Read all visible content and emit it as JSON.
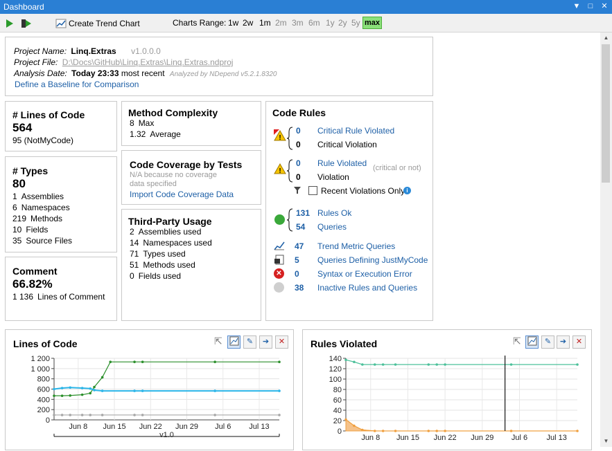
{
  "window": {
    "title": "Dashboard"
  },
  "toolbar": {
    "create_trend_chart": "Create Trend Chart",
    "charts_range_label": "Charts Range:",
    "ranges": [
      "1w",
      "2w",
      "1m",
      "2m",
      "3m",
      "6m",
      "1y",
      "2y",
      "5y"
    ],
    "max": "max"
  },
  "project": {
    "name_label": "Project Name:",
    "name": "Linq.Extras",
    "version": "v1.0.0.0",
    "file_label": "Project File:",
    "file": "D:\\Docs\\GitHub\\Linq.Extras\\Linq.Extras.ndproj",
    "date_label": "Analysis Date:",
    "date": "Today 23:33",
    "most_recent": "most recent",
    "analyzed_by": "Analyzed by NDepend v5.2.1.8320",
    "baseline_link": "Define a Baseline for Comparison"
  },
  "loc": {
    "title": "# Lines of Code",
    "value": "564",
    "not_my_code": "95  (NotMyCode)"
  },
  "types": {
    "title": "# Types",
    "value": "80",
    "rows": [
      {
        "n": "1",
        "label": "Assemblies"
      },
      {
        "n": "6",
        "label": "Namespaces"
      },
      {
        "n": "219",
        "label": "Methods"
      },
      {
        "n": "10",
        "label": "Fields"
      },
      {
        "n": "35",
        "label": "Source Files"
      }
    ]
  },
  "comment": {
    "title": "Comment",
    "value": "66.82%",
    "n": "1 136",
    "label": "Lines of Comment"
  },
  "complexity": {
    "title": "Method Complexity",
    "max_n": "8",
    "max_label": "Max",
    "avg_n": "1.32",
    "avg_label": "Average"
  },
  "coverage": {
    "title": "Code Coverage by Tests",
    "na": "N/A because no coverage",
    "na2": "data specified",
    "import_link": "Import Code Coverage Data"
  },
  "third_party": {
    "title": "Third-Party Usage",
    "rows": [
      {
        "n": "2",
        "label": "Assemblies used"
      },
      {
        "n": "14",
        "label": "Namespaces used"
      },
      {
        "n": "71",
        "label": "Types used"
      },
      {
        "n": "51",
        "label": "Methods used"
      },
      {
        "n": "0",
        "label": "Fields used"
      }
    ]
  },
  "code_rules": {
    "title": "Code Rules",
    "critical_n": "0",
    "critical_label": "Critical Rule Violated",
    "critical_viol_n": "0",
    "critical_viol_label": "Critical Violation",
    "violated_n": "0",
    "violated_label": "Rule Violated",
    "critical_or_not": "(critical or not)",
    "violation_n": "0",
    "violation_label": "Violation",
    "recent_only": "Recent Violations Only",
    "ok_n": "131",
    "ok_label": "Rules Ok",
    "queries_n": "54",
    "queries_label": "Queries",
    "trend_n": "47",
    "trend_label": "Trend Metric Queries",
    "jmc_n": "5",
    "jmc_label": "Queries Defining JustMyCode",
    "err_n": "0",
    "err_label": "Syntax or Execution Error",
    "inactive_n": "38",
    "inactive_label": "Inactive Rules and Queries"
  },
  "chart_data": [
    {
      "type": "line",
      "title": "Lines of Code",
      "ylim": [
        0,
        1200
      ],
      "y_ticks": [
        "1 200",
        "1 000",
        "800",
        "600",
        "400",
        "200",
        "0"
      ],
      "x_ticks": [
        "Jun 8",
        "Jun 15",
        "Jun 22",
        "Jun 29",
        "Jul 6",
        "Jul 13"
      ],
      "annotation": "v1.0",
      "series": [
        {
          "color": "#2a8f2a",
          "x": [
            0,
            2,
            4,
            7,
            9,
            10,
            12,
            14,
            20,
            22,
            40,
            56
          ],
          "values": [
            470,
            470,
            475,
            490,
            520,
            640,
            830,
            1130,
            1130,
            1130,
            1130,
            1130
          ]
        },
        {
          "color": "#2bb5e8",
          "x": [
            0,
            2,
            4,
            7,
            9,
            10,
            12,
            20,
            22,
            40,
            56
          ],
          "values": [
            600,
            620,
            630,
            620,
            610,
            580,
            565,
            565,
            565,
            565,
            565
          ]
        },
        {
          "color": "#a8a8a8",
          "x": [
            0,
            2,
            4,
            7,
            9,
            12,
            20,
            22,
            40,
            56
          ],
          "values": [
            95,
            95,
            95,
            95,
            95,
            95,
            95,
            95,
            95,
            95
          ]
        }
      ]
    },
    {
      "type": "line",
      "title": "Rules Violated",
      "ylim": [
        0,
        140
      ],
      "y_ticks": [
        "140",
        "120",
        "100",
        "80",
        "60",
        "40",
        "20",
        "0"
      ],
      "x_ticks": [
        "Jun 8",
        "Jun 15",
        "Jun 22",
        "Jun 29",
        "Jul 6",
        "Jul 13"
      ],
      "series": [
        {
          "color": "#4cc09a",
          "x": [
            0,
            2,
            4,
            7,
            9,
            12,
            20,
            22,
            24,
            40,
            56
          ],
          "values": [
            137,
            133,
            128,
            128,
            128,
            128,
            128,
            128,
            128,
            128,
            128
          ]
        },
        {
          "color": "#f0a040",
          "x": [
            0,
            2,
            4,
            7,
            9,
            12,
            20,
            22,
            24,
            40,
            56
          ],
          "values": [
            22,
            10,
            2,
            0,
            0,
            0,
            0,
            0,
            0,
            0,
            0
          ]
        }
      ]
    }
  ]
}
